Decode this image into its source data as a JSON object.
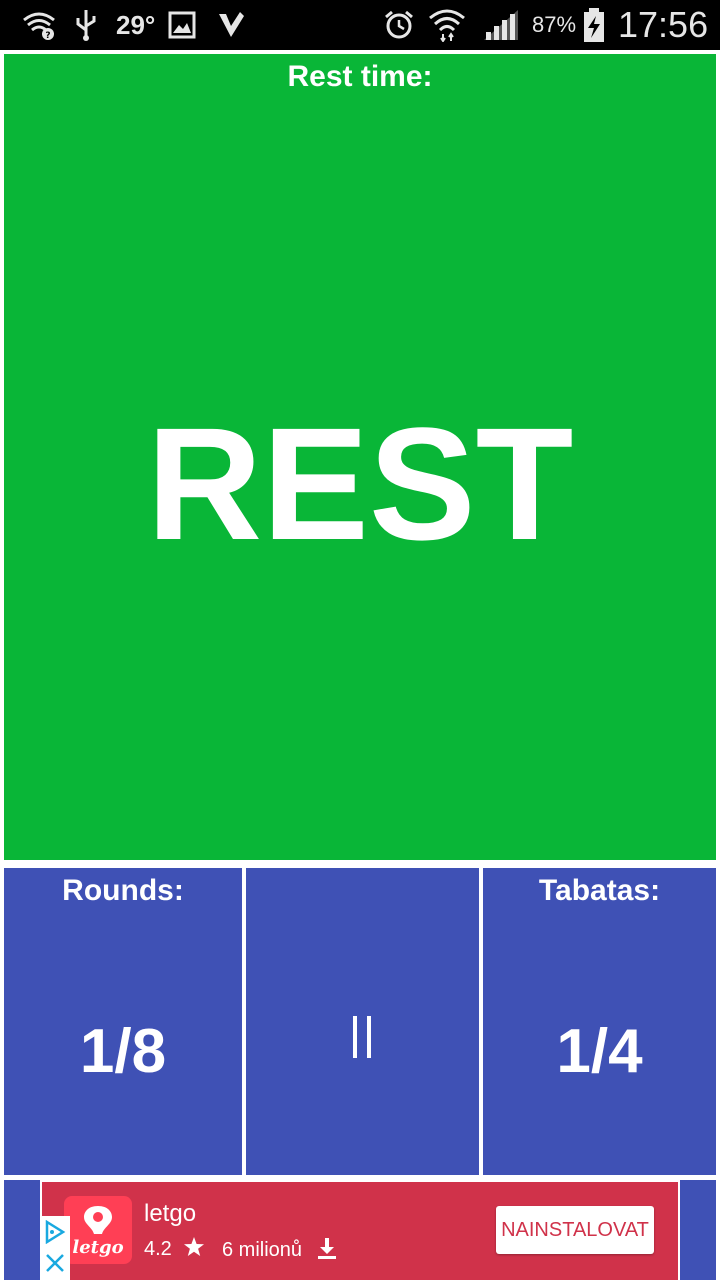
{
  "status_bar": {
    "temperature": "29°",
    "battery_percent": "87%",
    "time": "17:56",
    "icons": [
      "wifi-question-icon",
      "usb-icon",
      "gallery-icon",
      "check-icon",
      "alarm-icon",
      "wifi-icon",
      "signal-icon",
      "battery-charging-icon"
    ]
  },
  "rest_panel": {
    "label": "Rest time:",
    "main_text": "REST",
    "color": "#09b637"
  },
  "rounds": {
    "label": "Rounds:",
    "value": "1/8"
  },
  "pause_button": {
    "icon": "pause-icon"
  },
  "tabatas": {
    "label": "Tabatas:",
    "value": "1/4"
  },
  "tile_color": "#3f51b5",
  "ad": {
    "app_name": "letgo",
    "logo_text": "letgo",
    "rating": "4.2",
    "downloads": "6 milionů",
    "install_label": "NAINSTALOVAT",
    "color": "#d0324a"
  }
}
